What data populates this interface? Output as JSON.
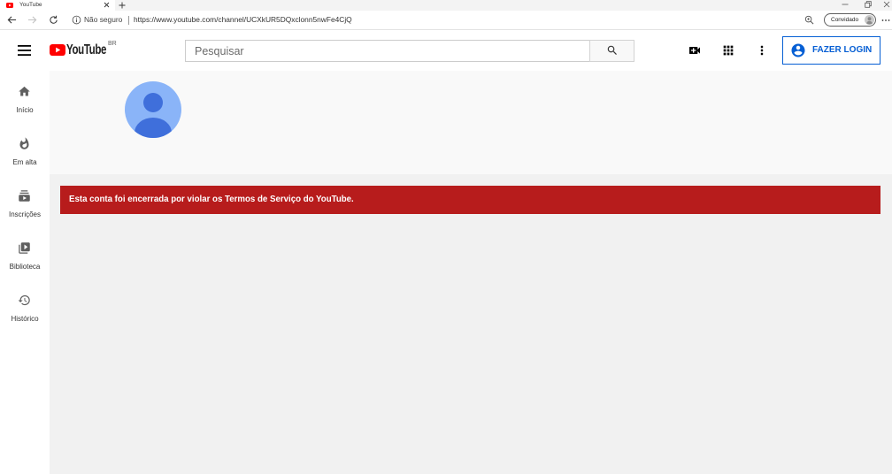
{
  "browser": {
    "tab": {
      "title": "YouTube"
    },
    "address": {
      "security_label": "Não seguro",
      "url": "https://www.youtube.com/channel/UCXkUR5DQxclonn5nwFe4CjQ"
    },
    "profile": {
      "label": "Convidado"
    }
  },
  "masthead": {
    "logo_text": "YouTube",
    "region": "BR",
    "search_placeholder": "Pesquisar",
    "login_label": "FAZER LOGIN"
  },
  "sidebar": {
    "items": [
      {
        "label": "Início",
        "icon": "home-icon"
      },
      {
        "label": "Em alta",
        "icon": "flame-icon"
      },
      {
        "label": "Inscrições",
        "icon": "subscriptions-icon"
      },
      {
        "label": "Biblioteca",
        "icon": "library-icon"
      },
      {
        "label": "Histórico",
        "icon": "history-icon"
      }
    ]
  },
  "channel": {
    "terminated_message": "Esta conta foi encerrada por violar os Termos de Serviço do YouTube."
  },
  "colors": {
    "brand_red": "#ff0000",
    "banner_red": "#b71c1c",
    "login_blue": "#065fd4",
    "avatar_light": "#8ab4f8",
    "avatar_dark": "#3f6fdb",
    "header_bg": "#f9f9f9",
    "page_bg": "#f1f1f1"
  }
}
